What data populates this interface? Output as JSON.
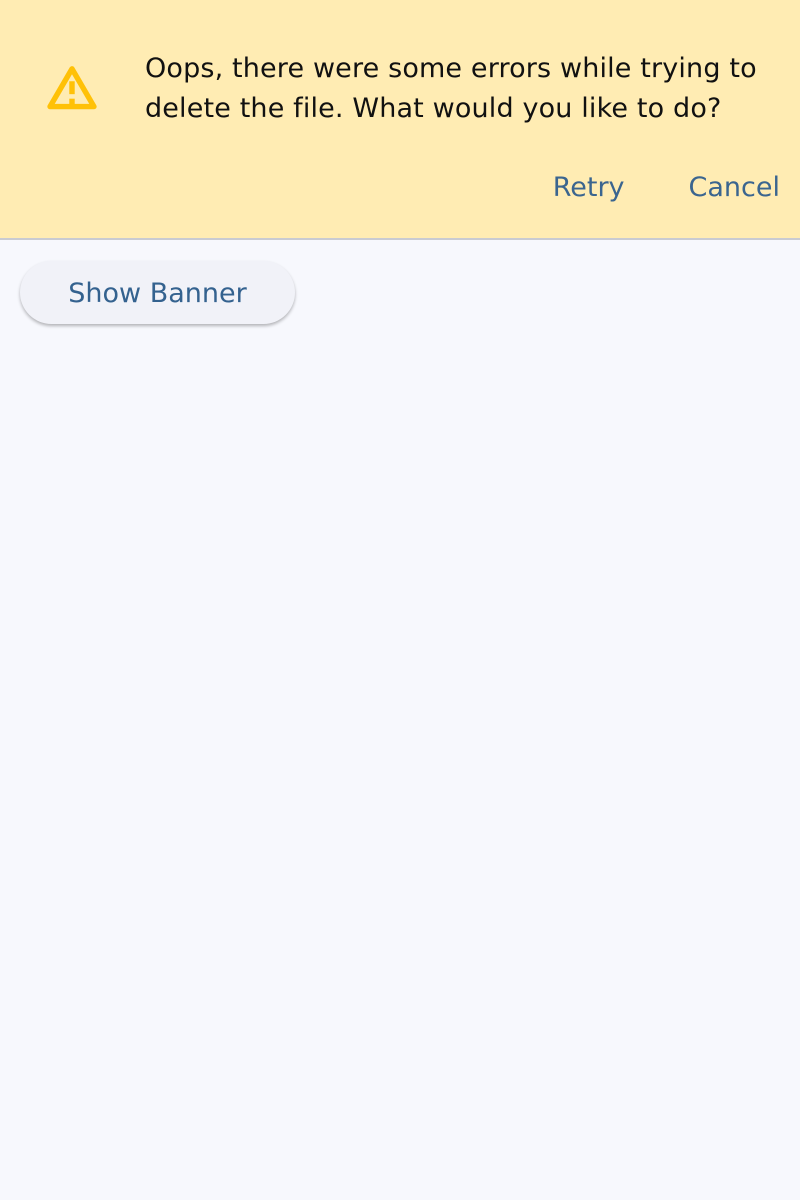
{
  "colors": {
    "background": "#f7f8fd",
    "banner_background": "#ffecb3",
    "warning_icon": "#ffc107",
    "primary_text": "#111111",
    "action_text": "#3b658f"
  },
  "banner": {
    "icon": "warning-icon",
    "message": "Oops, there were some errors while trying to delete the file. What would you like to do?",
    "actions": {
      "retry": "Retry",
      "cancel": "Cancel"
    }
  },
  "main": {
    "show_banner_label": "Show Banner"
  }
}
